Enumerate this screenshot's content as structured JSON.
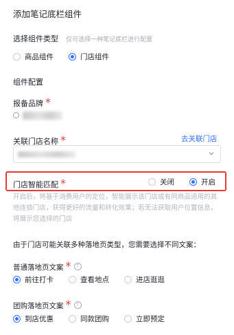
{
  "page_title": "添加笔记底栏组件",
  "component_type": {
    "label": "选择组件类型",
    "hint": "仅可选择一种笔记底栏进行配置",
    "options": [
      {
        "label": "商品组件",
        "checked": false
      },
      {
        "label": "门店组件",
        "checked": true
      }
    ]
  },
  "section_title": "组件配置",
  "brand": {
    "label": "报备品牌",
    "required_mark": "*"
  },
  "store_name": {
    "label": "关联门店名称",
    "required_mark": "*",
    "link": "去关联门店"
  },
  "smart_match": {
    "label": "门店智能匹配",
    "required_mark": "*",
    "options": [
      {
        "label": "关闭",
        "checked": false
      },
      {
        "label": "开启",
        "checked": true
      }
    ],
    "description": "开启后，将基于消费用户的定位，智能展示该门店或有同商品适用的其他连锁门店，获得更好的流量和转化效果；若无法获取用户位置信息，将展示您选择的门店"
  },
  "notice": "由于门店可能关联多种落地页类型，您需要选择不同文案：",
  "normal_copy": {
    "label": "普通落地页文案",
    "required_mark": "*",
    "help": "?",
    "options": [
      {
        "label": "前往打卡",
        "checked": true
      },
      {
        "label": "查看地点",
        "checked": false
      },
      {
        "label": "进店逛逛",
        "checked": false
      }
    ]
  },
  "group_copy": {
    "label": "团购落地页文案",
    "required_mark": "*",
    "help": "?",
    "options": [
      {
        "label": "到店优惠",
        "checked": true
      },
      {
        "label": "同款团购",
        "checked": false
      },
      {
        "label": "立即预定",
        "checked": false
      }
    ]
  },
  "colors": {
    "accent": "#3370ff",
    "required": "#e23c39",
    "highlight_border": "#e53935"
  }
}
